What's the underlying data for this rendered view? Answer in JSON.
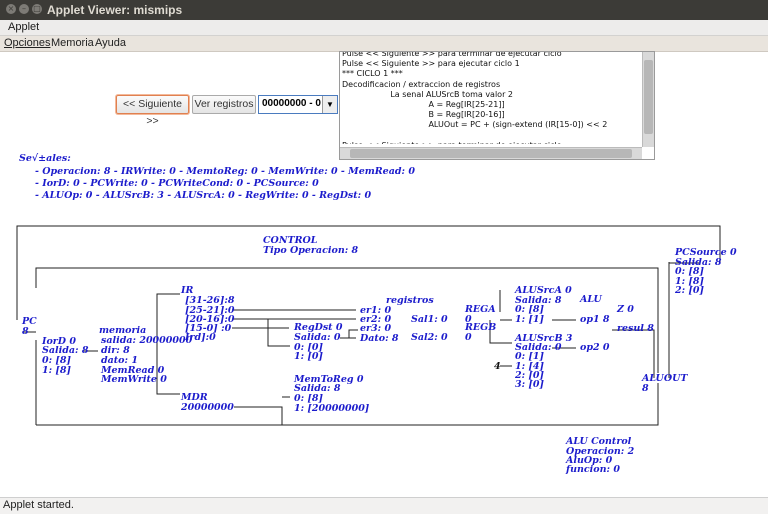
{
  "window": {
    "title": "Applet Viewer: mismips"
  },
  "menubar": {
    "applet": "Applet"
  },
  "appmenu": {
    "opciones": "Opciones",
    "memoria": "Memoria",
    "ayuda": "Ayuda"
  },
  "controls": {
    "siguiente": "<< Siguiente >>",
    "ver_registros": "Ver registros",
    "combo_value": "00000000 - 0"
  },
  "console": {
    "lines": [
      "Pulse << Siguiente >> para terminar de ejecutar ciclo",
      "Pulse << Siguiente >> para ejecutar ciclo 1",
      "*** CICLO 1 ***",
      "Decodificacion / extraccion de registros",
      "                   La senal ALUSrcB toma valor 2",
      "                                  A = Reg[IR[25-21]]",
      "                                  B = Reg[IR[20-16]]",
      "                                  ALUOut = PC + (sign-extend (IR[15-0]) << 2",
      "",
      "Pulse << Siguiente >> para terminar de ejecutar ciclo"
    ]
  },
  "signals": {
    "title": "Se√±ales:",
    "line1": "- Operacion: 8 - IRWrite: 0 - MemtoReg: 0 - MemWrite: 0 - MemRead: 0",
    "line2": "- IorD: 0 - PCWrite: 0 - PCWriteCond: 0 - PCSource: 0",
    "line3": "- ALUOp: 0 - ALUSrcB: 3 - ALUSrcA: 0 - RegWrite: 0 - RegDst: 0"
  },
  "control": {
    "title": "CONTROL",
    "tipo": "Tipo Operacion: 8"
  },
  "pc": {
    "label": "PC",
    "value": "8"
  },
  "iord": {
    "title": "IorD 0",
    "salida": "Salida: 8",
    "in0": "0: [8]",
    "in1": "1: [8]"
  },
  "memoria": {
    "title": "memoria",
    "salida": "salida: 20000000",
    "dir": "dir: 8",
    "dato": "dato: 1",
    "memread": "MemRead 0",
    "memwrite": "MemWrite 0"
  },
  "ir": {
    "title": "IR",
    "f1": "[31-26]:8",
    "f2": "[25-21]:0",
    "f3": "[20-16]:0",
    "f4": "[15-0] :0",
    "f5": "Ird]:0"
  },
  "mdr": {
    "title": "MDR",
    "value": "20000000"
  },
  "regdst": {
    "title": "RegDst 0",
    "salida": "Salida: 0",
    "in0": "0: [0]",
    "in1": "1: [0]"
  },
  "memtoreg": {
    "title": "MemToReg 0",
    "salida": "Salida: 8",
    "in0": "0: [8]",
    "in1": "1: [20000000]"
  },
  "registros": {
    "title": "registros",
    "er1": "er1: 0",
    "er2": "er2: 0",
    "er3": "er3: 0",
    "dato": "Dato: 8",
    "sal1": "Sal1: 0",
    "sal2": "Sal2: 0"
  },
  "rega": {
    "title": "REGA",
    "value": "0"
  },
  "regb": {
    "title": "REGB",
    "value": "0"
  },
  "alusrca": {
    "title": "ALUSrcA 0",
    "salida": "Salida: 8",
    "in0": "0: [8]",
    "in1": "1: [1]"
  },
  "alusrcb": {
    "title": "ALUSrcB 3",
    "salida": "Salida: 0",
    "in0": "0: [1]",
    "in1": "1: [4]",
    "in2": "2: [0]",
    "in3": "3: [0]",
    "const": "4"
  },
  "alu": {
    "title": "ALU",
    "op1": "op1 8",
    "op2": "op2 0",
    "z": "Z 0",
    "resul": "resul 8"
  },
  "pcsource": {
    "title": "PCSource 0",
    "salida": "Salida: 8",
    "in0": "0: [8]",
    "in1": "1: [8]",
    "in2": "2: [0]"
  },
  "aluout": {
    "title": "ALUOUT",
    "value": "8"
  },
  "alucontrol": {
    "title": "ALU Control",
    "operacion": "Operacion: 2",
    "aluop": "AluOp: 0",
    "funcion": "funcion: 0"
  },
  "status": {
    "text": "Applet started."
  }
}
